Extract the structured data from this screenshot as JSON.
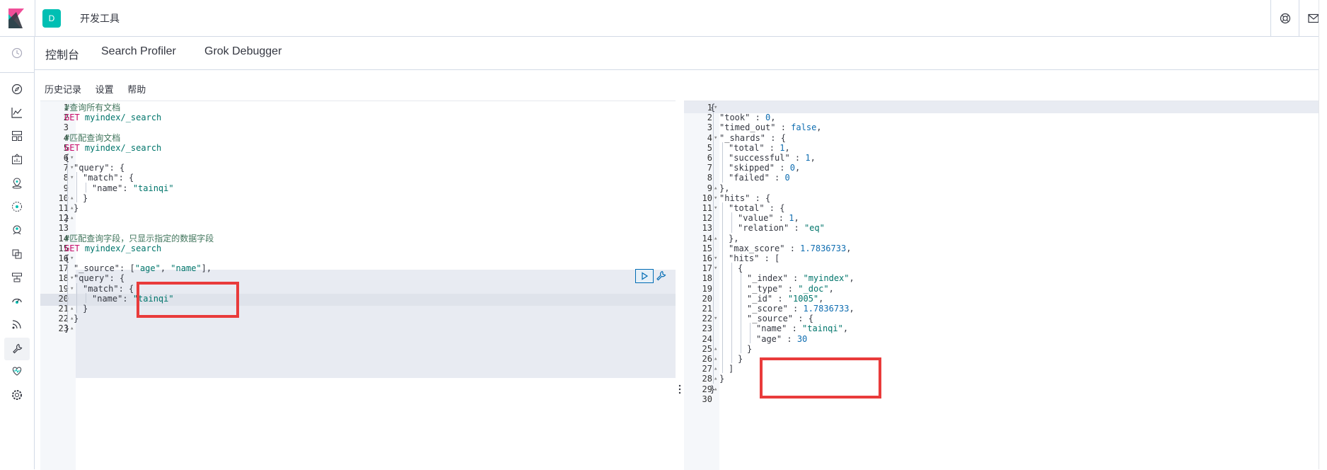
{
  "header": {
    "space_initial": "D",
    "app_title": "开发工具",
    "logo_icon": "kibana-logo",
    "help_icon": "help-lifebuoy-icon",
    "mail_icon": "mail-icon"
  },
  "sidenav": {
    "icons": [
      "clock-icon",
      "discover-compass-icon",
      "visualize-chart-icon",
      "dashboard-icon",
      "canvas-icon",
      "maps-icon",
      "ml-icon",
      "graph-icon",
      "infrastructure-icon",
      "logs-icon",
      "apm-icon",
      "uptime-icon",
      "siem-icon",
      "devtools-icon",
      "monitoring-icon",
      "management-gear-icon"
    ]
  },
  "tabs": [
    {
      "label": "控制台",
      "active": true
    },
    {
      "label": "Search Profiler",
      "active": false
    },
    {
      "label": "Grok Debugger",
      "active": false
    }
  ],
  "menu": {
    "history": "历史记录",
    "settings": "设置",
    "help": "帮助"
  },
  "editor": {
    "lines": [
      {
        "n": "1",
        "fold": "",
        "indent": 0,
        "tokens": [
          [
            "c-comment",
            "#查询所有文档"
          ]
        ]
      },
      {
        "n": "2",
        "fold": "",
        "indent": 0,
        "tokens": [
          [
            "c-method",
            "GET"
          ],
          [
            "c-url",
            " myindex/_search"
          ]
        ]
      },
      {
        "n": "3",
        "fold": "",
        "indent": 0,
        "tokens": []
      },
      {
        "n": "4",
        "fold": "",
        "indent": 0,
        "tokens": [
          [
            "c-comment",
            "#匹配查询文档"
          ]
        ]
      },
      {
        "n": "5",
        "fold": "",
        "indent": 0,
        "tokens": [
          [
            "c-method",
            "GET"
          ],
          [
            "c-url",
            " myindex/_search"
          ]
        ]
      },
      {
        "n": "6",
        "fold": "▾",
        "indent": 0,
        "tokens": [
          [
            "c-punc",
            "{"
          ]
        ]
      },
      {
        "n": "7",
        "fold": "▾",
        "indent": 1,
        "tokens": [
          [
            "c-key",
            "\"query\""
          ],
          [
            "c-punc",
            ": {"
          ]
        ]
      },
      {
        "n": "8",
        "fold": "▾",
        "indent": 2,
        "tokens": [
          [
            "c-key",
            "\"match\""
          ],
          [
            "c-punc",
            ": {"
          ]
        ]
      },
      {
        "n": "9",
        "fold": "",
        "indent": 3,
        "tokens": [
          [
            "c-key",
            "\"name\""
          ],
          [
            "c-punc",
            ": "
          ],
          [
            "c-str",
            "\"tainqi\""
          ]
        ]
      },
      {
        "n": "10",
        "fold": "▴",
        "indent": 2,
        "tokens": [
          [
            "c-punc",
            "}"
          ]
        ]
      },
      {
        "n": "11",
        "fold": "▴",
        "indent": 1,
        "tokens": [
          [
            "c-punc",
            "}"
          ]
        ]
      },
      {
        "n": "12",
        "fold": "▴",
        "indent": 0,
        "tokens": [
          [
            "c-punc",
            "}"
          ]
        ]
      },
      {
        "n": "13",
        "fold": "",
        "indent": 0,
        "tokens": []
      },
      {
        "n": "14",
        "fold": "",
        "indent": 0,
        "tokens": [
          [
            "c-comment",
            "#匹配查询字段，只显示指定的数据字段"
          ]
        ]
      },
      {
        "n": "15",
        "fold": "",
        "indent": 0,
        "tokens": [
          [
            "c-method",
            "GET"
          ],
          [
            "c-url",
            " myindex/_search"
          ]
        ]
      },
      {
        "n": "16",
        "fold": "▾",
        "indent": 0,
        "tokens": [
          [
            "c-punc",
            "{"
          ]
        ]
      },
      {
        "n": "17",
        "fold": "",
        "indent": 1,
        "tokens": [
          [
            "c-key",
            "\"_source\""
          ],
          [
            "c-punc",
            ": ["
          ],
          [
            "c-str",
            "\"age\""
          ],
          [
            "c-punc",
            ", "
          ],
          [
            "c-str",
            "\"name\""
          ],
          [
            "c-punc",
            "],"
          ]
        ]
      },
      {
        "n": "18",
        "fold": "▾",
        "indent": 1,
        "tokens": [
          [
            "c-key",
            "\"query\""
          ],
          [
            "c-punc",
            ": {"
          ]
        ]
      },
      {
        "n": "19",
        "fold": "▾",
        "indent": 2,
        "tokens": [
          [
            "c-key",
            "\"match\""
          ],
          [
            "c-punc",
            ": {"
          ]
        ]
      },
      {
        "n": "20",
        "fold": "",
        "indent": 3,
        "tokens": [
          [
            "c-key",
            "\"name\""
          ],
          [
            "c-punc",
            ": "
          ],
          [
            "c-str",
            "\"tainqi\""
          ]
        ]
      },
      {
        "n": "21",
        "fold": "▴",
        "indent": 2,
        "tokens": [
          [
            "c-punc",
            "}"
          ]
        ]
      },
      {
        "n": "22",
        "fold": "▴",
        "indent": 1,
        "tokens": [
          [
            "c-punc",
            "}"
          ]
        ]
      },
      {
        "n": "23",
        "fold": "▴",
        "indent": 0,
        "tokens": [
          [
            "c-punc",
            "}"
          ]
        ]
      }
    ]
  },
  "output": {
    "lines": [
      {
        "n": "1",
        "fold": "▾",
        "indent": 0,
        "tokens": [
          [
            "c-punc",
            "{"
          ]
        ]
      },
      {
        "n": "2",
        "fold": "",
        "indent": 1,
        "tokens": [
          [
            "c-key",
            "\"took\""
          ],
          [
            "c-punc",
            " : "
          ],
          [
            "c-num",
            "0"
          ],
          [
            "c-punc",
            ","
          ]
        ]
      },
      {
        "n": "3",
        "fold": "",
        "indent": 1,
        "tokens": [
          [
            "c-key",
            "\"timed_out\""
          ],
          [
            "c-punc",
            " : "
          ],
          [
            "c-bool",
            "false"
          ],
          [
            "c-punc",
            ","
          ]
        ]
      },
      {
        "n": "4",
        "fold": "▾",
        "indent": 1,
        "tokens": [
          [
            "c-key",
            "\"_shards\""
          ],
          [
            "c-punc",
            " : {"
          ]
        ]
      },
      {
        "n": "5",
        "fold": "",
        "indent": 2,
        "tokens": [
          [
            "c-key",
            "\"total\""
          ],
          [
            "c-punc",
            " : "
          ],
          [
            "c-num",
            "1"
          ],
          [
            "c-punc",
            ","
          ]
        ]
      },
      {
        "n": "6",
        "fold": "",
        "indent": 2,
        "tokens": [
          [
            "c-key",
            "\"successful\""
          ],
          [
            "c-punc",
            " : "
          ],
          [
            "c-num",
            "1"
          ],
          [
            "c-punc",
            ","
          ]
        ]
      },
      {
        "n": "7",
        "fold": "",
        "indent": 2,
        "tokens": [
          [
            "c-key",
            "\"skipped\""
          ],
          [
            "c-punc",
            " : "
          ],
          [
            "c-num",
            "0"
          ],
          [
            "c-punc",
            ","
          ]
        ]
      },
      {
        "n": "8",
        "fold": "",
        "indent": 2,
        "tokens": [
          [
            "c-key",
            "\"failed\""
          ],
          [
            "c-punc",
            " : "
          ],
          [
            "c-num",
            "0"
          ]
        ]
      },
      {
        "n": "9",
        "fold": "▴",
        "indent": 1,
        "tokens": [
          [
            "c-punc",
            "},"
          ]
        ]
      },
      {
        "n": "10",
        "fold": "▾",
        "indent": 1,
        "tokens": [
          [
            "c-key",
            "\"hits\""
          ],
          [
            "c-punc",
            " : {"
          ]
        ]
      },
      {
        "n": "11",
        "fold": "▾",
        "indent": 2,
        "tokens": [
          [
            "c-key",
            "\"total\""
          ],
          [
            "c-punc",
            " : {"
          ]
        ]
      },
      {
        "n": "12",
        "fold": "",
        "indent": 3,
        "tokens": [
          [
            "c-key",
            "\"value\""
          ],
          [
            "c-punc",
            " : "
          ],
          [
            "c-num",
            "1"
          ],
          [
            "c-punc",
            ","
          ]
        ]
      },
      {
        "n": "13",
        "fold": "",
        "indent": 3,
        "tokens": [
          [
            "c-key",
            "\"relation\""
          ],
          [
            "c-punc",
            " : "
          ],
          [
            "c-str",
            "\"eq\""
          ]
        ]
      },
      {
        "n": "14",
        "fold": "▴",
        "indent": 2,
        "tokens": [
          [
            "c-punc",
            "},"
          ]
        ]
      },
      {
        "n": "15",
        "fold": "",
        "indent": 2,
        "tokens": [
          [
            "c-key",
            "\"max_score\""
          ],
          [
            "c-punc",
            " : "
          ],
          [
            "c-num",
            "1.7836733"
          ],
          [
            "c-punc",
            ","
          ]
        ]
      },
      {
        "n": "16",
        "fold": "▾",
        "indent": 2,
        "tokens": [
          [
            "c-key",
            "\"hits\""
          ],
          [
            "c-punc",
            " : ["
          ]
        ]
      },
      {
        "n": "17",
        "fold": "▾",
        "indent": 3,
        "tokens": [
          [
            "c-punc",
            "{"
          ]
        ]
      },
      {
        "n": "18",
        "fold": "",
        "indent": 4,
        "tokens": [
          [
            "c-key",
            "\"_index\""
          ],
          [
            "c-punc",
            " : "
          ],
          [
            "c-str",
            "\"myindex\""
          ],
          [
            "c-punc",
            ","
          ]
        ]
      },
      {
        "n": "19",
        "fold": "",
        "indent": 4,
        "tokens": [
          [
            "c-key",
            "\"_type\""
          ],
          [
            "c-punc",
            " : "
          ],
          [
            "c-str",
            "\"_doc\""
          ],
          [
            "c-punc",
            ","
          ]
        ]
      },
      {
        "n": "20",
        "fold": "",
        "indent": 4,
        "tokens": [
          [
            "c-key",
            "\"_id\""
          ],
          [
            "c-punc",
            " : "
          ],
          [
            "c-str",
            "\"1005\""
          ],
          [
            "c-punc",
            ","
          ]
        ]
      },
      {
        "n": "21",
        "fold": "",
        "indent": 4,
        "tokens": [
          [
            "c-key",
            "\"_score\""
          ],
          [
            "c-punc",
            " : "
          ],
          [
            "c-num",
            "1.7836733"
          ],
          [
            "c-punc",
            ","
          ]
        ]
      },
      {
        "n": "22",
        "fold": "▾",
        "indent": 4,
        "tokens": [
          [
            "c-key",
            "\"_source\""
          ],
          [
            "c-punc",
            " : {"
          ]
        ]
      },
      {
        "n": "23",
        "fold": "",
        "indent": 5,
        "tokens": [
          [
            "c-key",
            "\"name\""
          ],
          [
            "c-punc",
            " : "
          ],
          [
            "c-str",
            "\"tainqi\""
          ],
          [
            "c-punc",
            ","
          ]
        ]
      },
      {
        "n": "24",
        "fold": "",
        "indent": 5,
        "tokens": [
          [
            "c-key",
            "\"age\""
          ],
          [
            "c-punc",
            " : "
          ],
          [
            "c-num",
            "30"
          ]
        ]
      },
      {
        "n": "25",
        "fold": "▴",
        "indent": 4,
        "tokens": [
          [
            "c-punc",
            "}"
          ]
        ]
      },
      {
        "n": "26",
        "fold": "▴",
        "indent": 3,
        "tokens": [
          [
            "c-punc",
            "}"
          ]
        ]
      },
      {
        "n": "27",
        "fold": "▴",
        "indent": 2,
        "tokens": [
          [
            "c-punc",
            "]"
          ]
        ]
      },
      {
        "n": "28",
        "fold": "▴",
        "indent": 1,
        "tokens": [
          [
            "c-punc",
            "}"
          ]
        ]
      },
      {
        "n": "29",
        "fold": "▴",
        "indent": 0,
        "tokens": [
          [
            "c-punc",
            "}"
          ]
        ]
      },
      {
        "n": "30",
        "fold": "",
        "indent": 0,
        "tokens": []
      }
    ]
  },
  "actions": {
    "run_icon": "play-icon",
    "wrench_icon": "wrench-icon"
  },
  "colors": {
    "accent": "#006bb4",
    "highlight_box": "#e93b3b",
    "space_badge": "#00bfb3"
  }
}
